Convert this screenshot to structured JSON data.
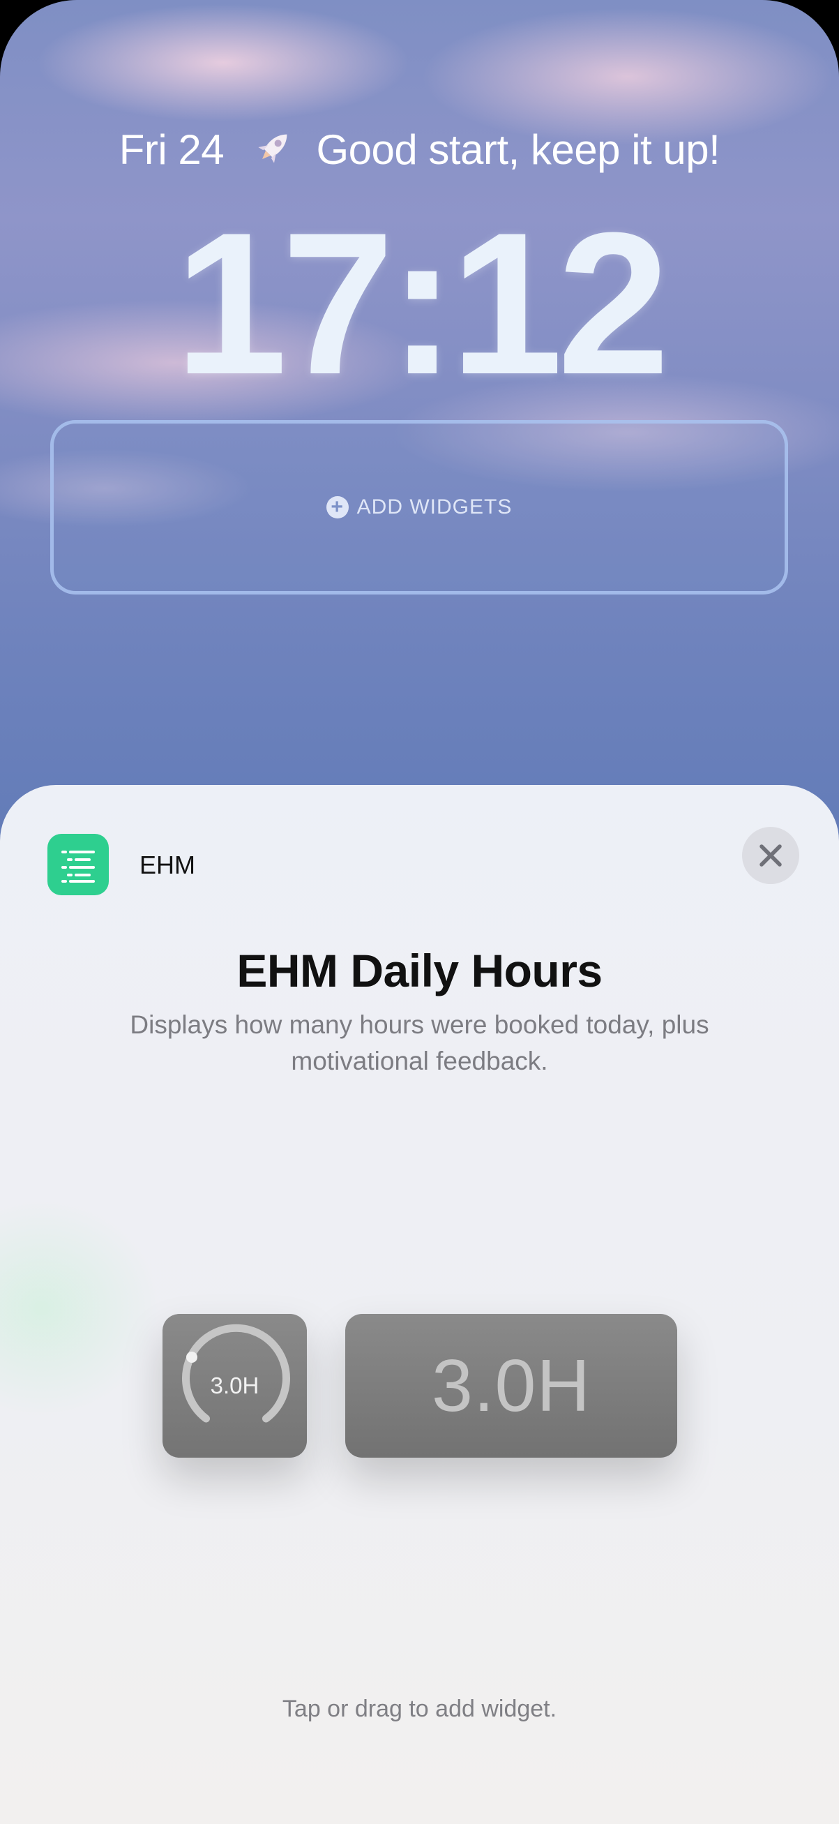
{
  "lock_screen": {
    "date": "Fri 24",
    "status_icon": "rocket-icon",
    "status_message": "Good start, keep it up!",
    "time": "17:12",
    "add_widgets_label": "ADD WIDGETS",
    "add_widgets_icon": "plus-circle-icon"
  },
  "sheet": {
    "app_name": "EHM",
    "app_icon": "list-icon",
    "app_icon_color": "#2ecf8f",
    "close_icon": "close-icon",
    "title": "EHM Daily Hours",
    "description": "Displays how many hours were booked today, plus motivational feedback.",
    "widgets": {
      "circular_value": "3.0H",
      "circular_progress": 0.75,
      "rectangular_value": "3.0H"
    },
    "hint": "Tap or drag to add widget."
  }
}
